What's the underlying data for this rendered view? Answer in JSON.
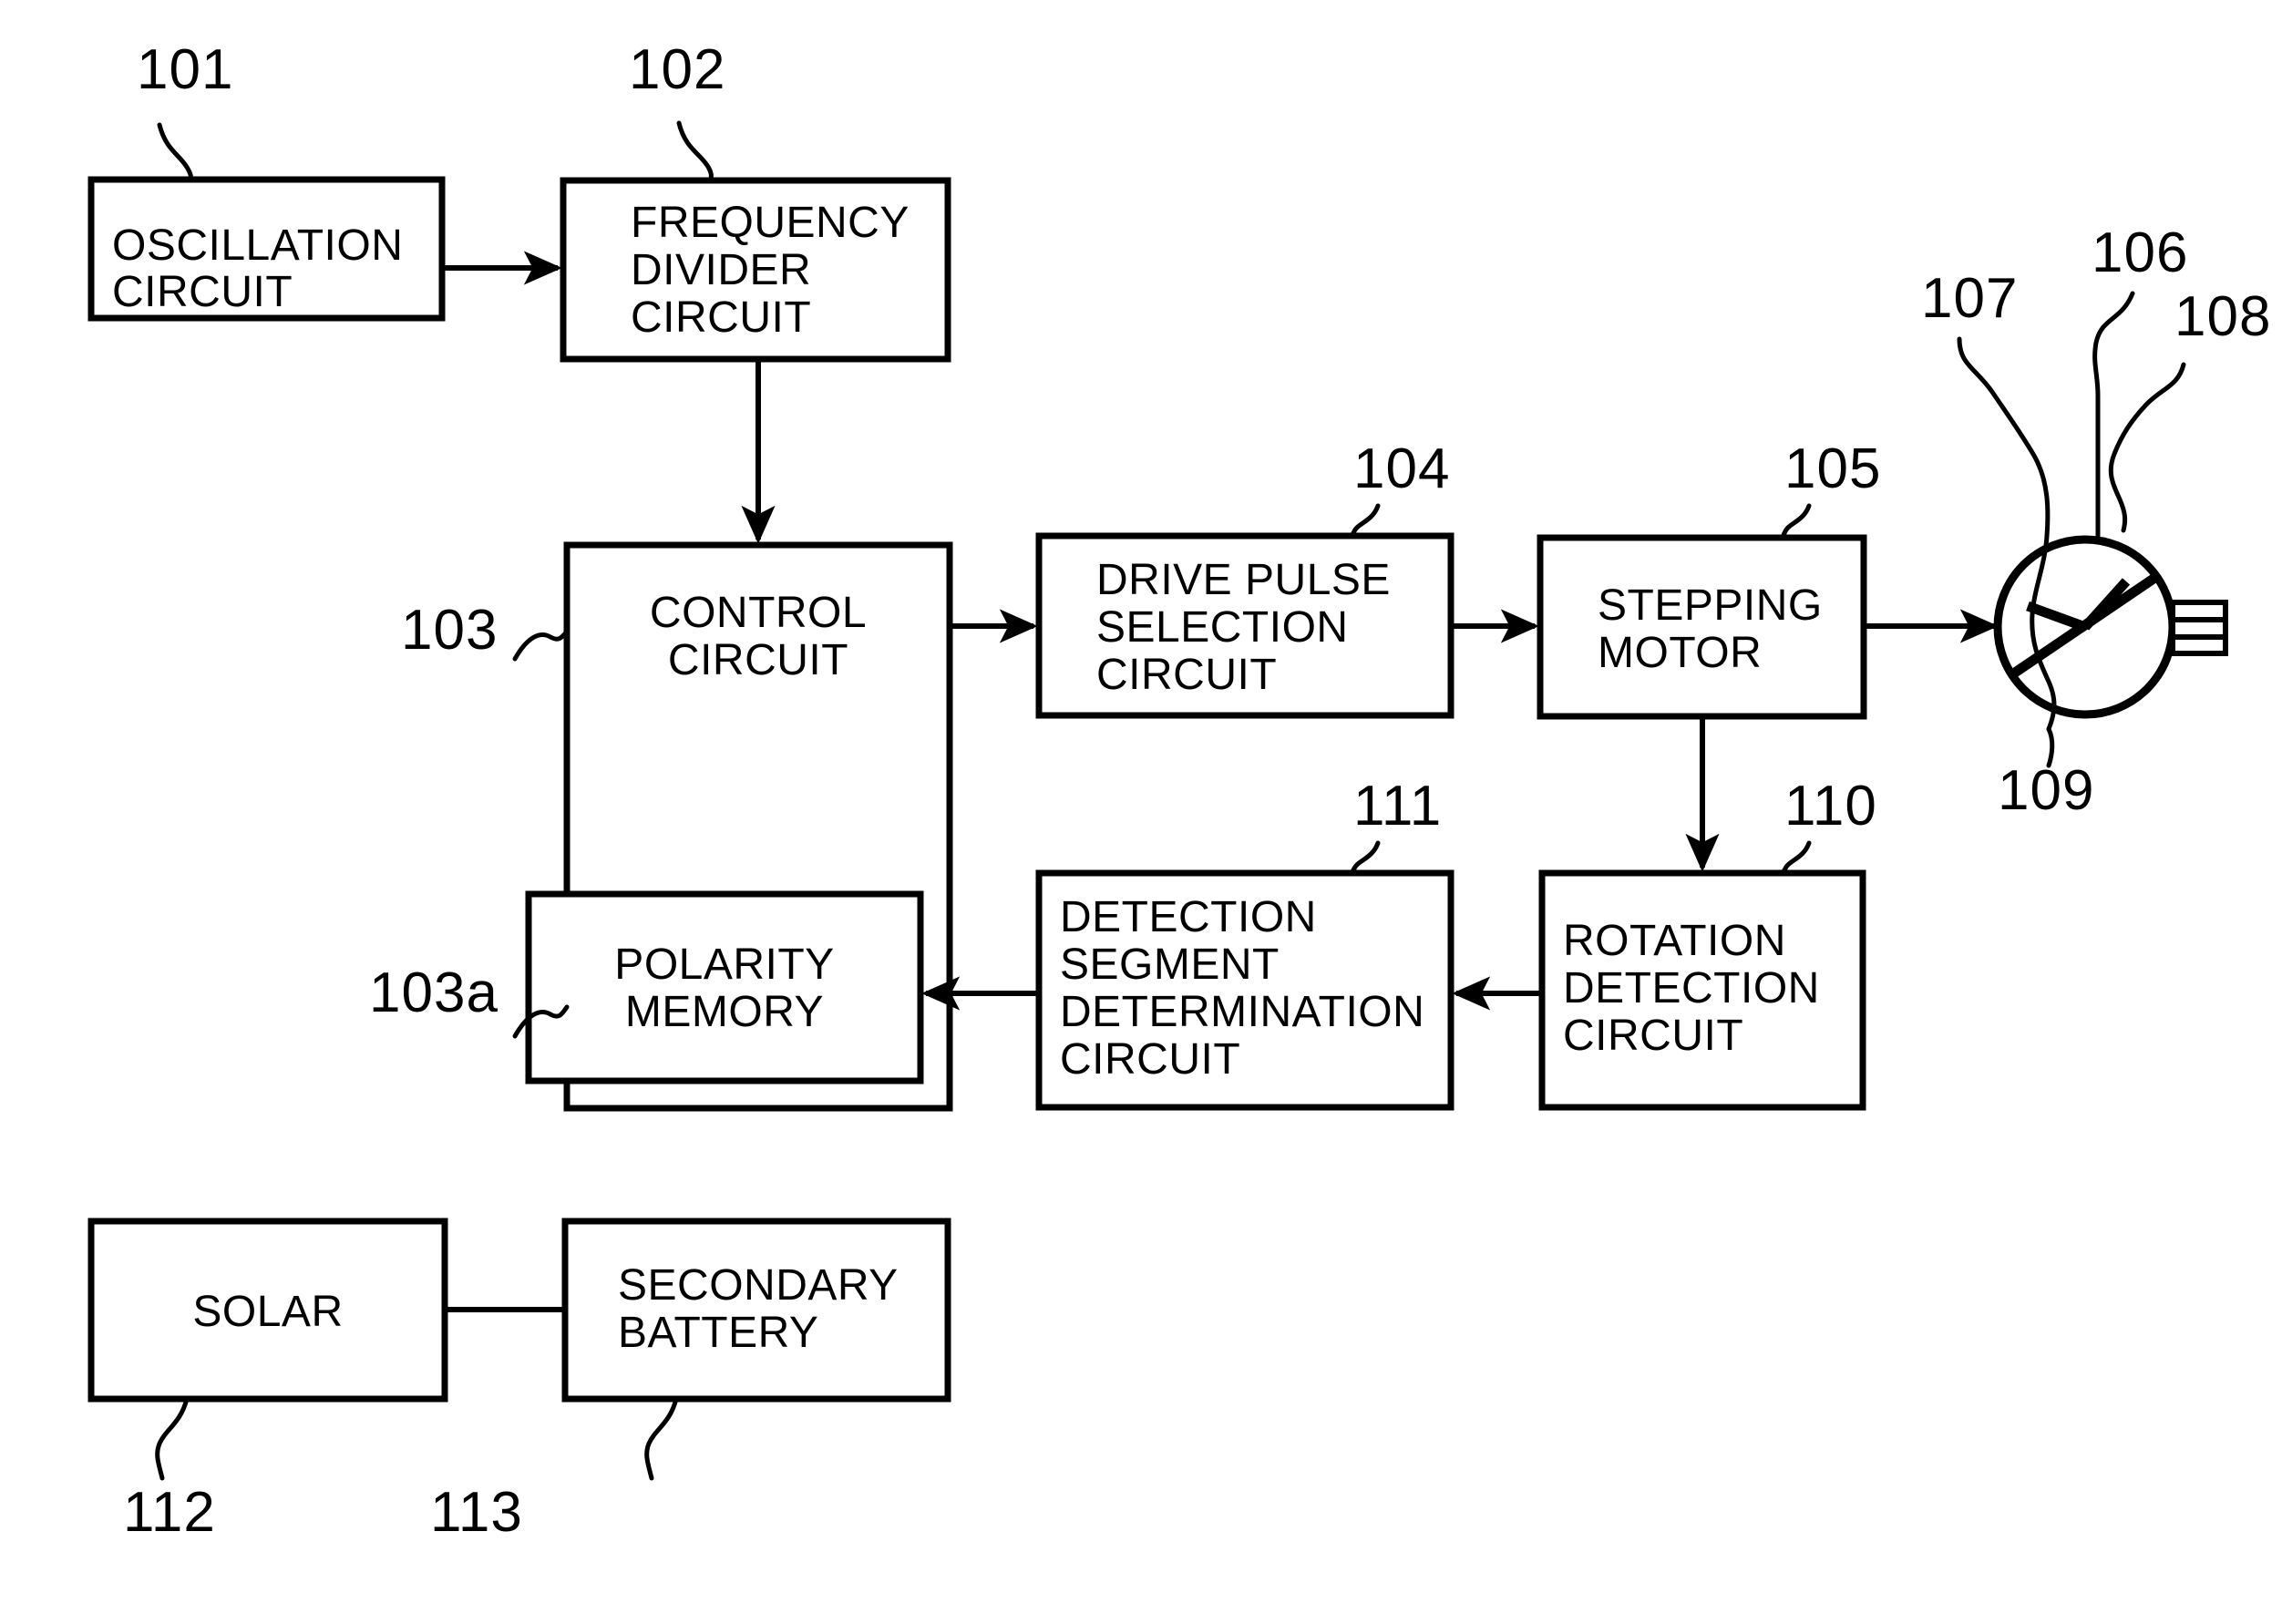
{
  "diagram": {
    "type": "patent-block-diagram",
    "title": "",
    "background_color": "#ffffff",
    "line_color": "#000000"
  },
  "blocks": {
    "oscillation": {
      "ref": "101",
      "lines": [
        "OSCILLATION",
        "CIRCUIT"
      ],
      "align": "left"
    },
    "frequency_divider": {
      "ref": "102",
      "lines": [
        "FREQUENCY",
        "DIVIDER",
        "CIRCUIT"
      ],
      "align": "left"
    },
    "control": {
      "ref": "103",
      "lines": [
        "CONTROL",
        "CIRCUIT"
      ],
      "align": "center"
    },
    "polarity_memory": {
      "ref": "103a",
      "lines": [
        "POLARITY",
        "MEMORY"
      ],
      "align": "center"
    },
    "drive_pulse": {
      "ref": "104",
      "lines": [
        "DRIVE PULSE",
        "SELECTION",
        "CIRCUIT"
      ],
      "align": "left"
    },
    "stepping_motor": {
      "ref": "105",
      "lines": [
        "STEPPING",
        "MOTOR"
      ],
      "align": "left"
    },
    "detection_segment": {
      "ref": "111",
      "lines": [
        "DETECTION",
        "SEGMENT",
        "DETERMINATION",
        "CIRCUIT"
      ],
      "align": "left"
    },
    "rotation_detection": {
      "ref": "110",
      "lines": [
        "ROTATION",
        "DETECTION",
        "CIRCUIT"
      ],
      "align": "left"
    },
    "solar": {
      "ref": "112",
      "lines": [
        "SOLAR"
      ],
      "align": "center"
    },
    "secondary_battery": {
      "ref": "113",
      "lines": [
        "SECONDARY",
        "BATTERY"
      ],
      "align": "left"
    }
  },
  "watch": {
    "ref_case": "106",
    "ref_hour_hand": "107",
    "ref_minute_hand": "108",
    "ref_second_hand": "109",
    "icon": "analog-watch-icon"
  },
  "refs": {
    "n101": "101",
    "n102": "102",
    "n103": "103",
    "n103a": "103a",
    "n104": "104",
    "n105": "105",
    "n106": "106",
    "n107": "107",
    "n108": "108",
    "n109": "109",
    "n110": "110",
    "n111": "111",
    "n112": "112",
    "n113": "113"
  }
}
